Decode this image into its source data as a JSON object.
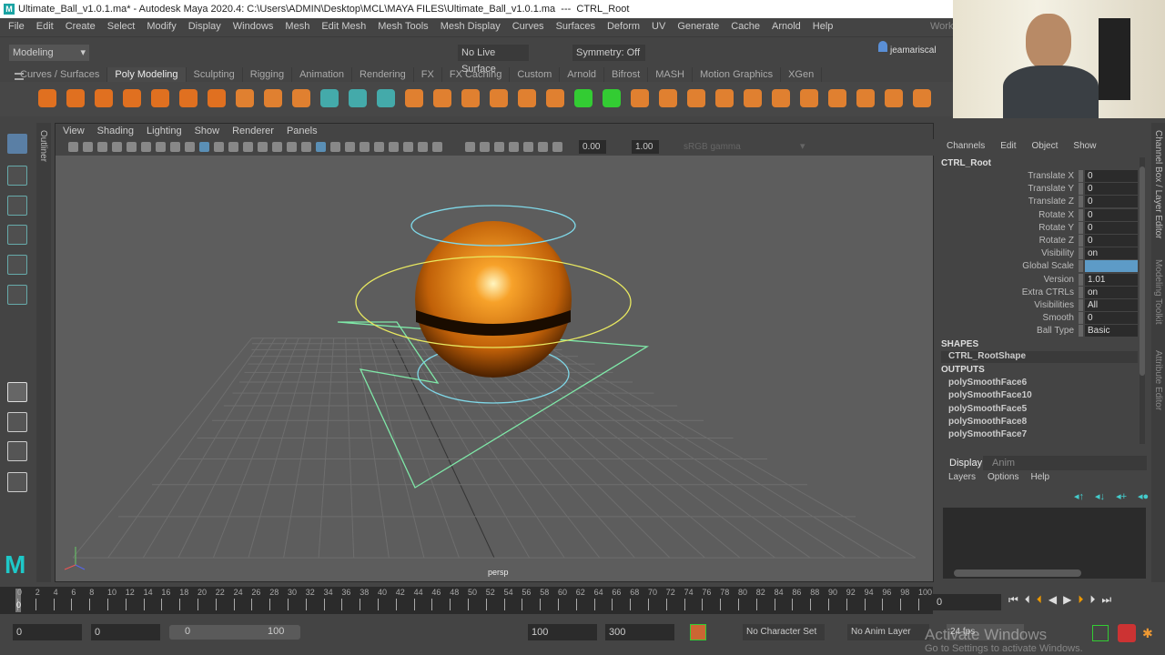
{
  "titlebar": {
    "title": "Ultimate_Ball_v1.0.1.ma* - Autodesk Maya 2020.4: C:\\Users\\ADMIN\\Desktop\\MCL\\MAYA FILES\\Ultimate_Ball_v1.0.1.ma  ---  CTRL_Root"
  },
  "menubar": [
    "File",
    "Edit",
    "Create",
    "Select",
    "Modify",
    "Display",
    "Windows",
    "Mesh",
    "Edit Mesh",
    "Mesh Tools",
    "Mesh Display",
    "Curves",
    "Surfaces",
    "Deform",
    "UV",
    "Generate",
    "Cache",
    "Arnold",
    "Help"
  ],
  "workspace_label": "Work",
  "status": {
    "mode": "Modeling",
    "live_surface": "No Live Surface",
    "symmetry": "Symmetry: Off",
    "user": "jeamariscal"
  },
  "shelf_tabs": [
    "Curves / Surfaces",
    "Poly Modeling",
    "Sculpting",
    "Rigging",
    "Animation",
    "Rendering",
    "FX",
    "FX Caching",
    "Custom",
    "Arnold",
    "Bifrost",
    "MASH",
    "Motion Graphics",
    "XGen"
  ],
  "shelf_active": "Poly Modeling",
  "outliner_tab": "Outliner",
  "viewport": {
    "menu": [
      "View",
      "Shading",
      "Lighting",
      "Show",
      "Renderer",
      "Panels"
    ],
    "exposure": "0.00",
    "gamma": "1.00",
    "color_space": "sRGB gamma",
    "camera": "persp"
  },
  "channel_box": {
    "menu": [
      "Channels",
      "Edit",
      "Object",
      "Show"
    ],
    "object": "CTRL_Root",
    "channels": [
      {
        "label": "Translate X",
        "value": "0"
      },
      {
        "label": "Translate Y",
        "value": "0"
      },
      {
        "label": "Translate Z",
        "value": "0"
      },
      {
        "label": "Rotate X",
        "value": "0"
      },
      {
        "label": "Rotate Y",
        "value": "0"
      },
      {
        "label": "Rotate Z",
        "value": "0"
      },
      {
        "label": "Visibility",
        "value": "on"
      },
      {
        "label": "Global Scale",
        "value": ""
      },
      {
        "label": "Version",
        "value": "1.01"
      },
      {
        "label": "Extra CTRLs",
        "value": "on"
      },
      {
        "label": "Visibilities",
        "value": "All"
      },
      {
        "label": "Smooth",
        "value": "0"
      },
      {
        "label": "Ball Type",
        "value": "Basic"
      }
    ],
    "shapes_header": "SHAPES",
    "shape": "CTRL_RootShape",
    "outputs_header": "OUTPUTS",
    "outputs": [
      "polySmoothFace6",
      "polySmoothFace10",
      "polySmoothFace5",
      "polySmoothFace8",
      "polySmoothFace7"
    ]
  },
  "layer_editor": {
    "tabs": [
      "Display",
      "Anim"
    ],
    "menu": [
      "Layers",
      "Options",
      "Help"
    ]
  },
  "side_tabs": [
    "Channel Box / Layer Editor",
    "Modeling Toolkit",
    "Attribute Editor"
  ],
  "timeline": {
    "ticks": [
      "0",
      "2",
      "4",
      "6",
      "8",
      "10",
      "12",
      "14",
      "16",
      "18",
      "20",
      "22",
      "24",
      "26",
      "28",
      "30",
      "32",
      "34",
      "36",
      "38",
      "40",
      "42",
      "44",
      "46",
      "48",
      "50",
      "52",
      "54",
      "56",
      "58",
      "60",
      "62",
      "64",
      "66",
      "68",
      "70",
      "72",
      "74",
      "76",
      "78",
      "80",
      "82",
      "84",
      "86",
      "88",
      "90",
      "92",
      "94",
      "96",
      "98",
      "100"
    ],
    "current_frame": "0",
    "current_field": "0"
  },
  "range": {
    "start": "0",
    "anim_start": "0",
    "slider_start": "0",
    "slider_end": "100",
    "end": "100",
    "anim_end": "300",
    "character_set": "No Character Set",
    "anim_layer": "No Anim Layer",
    "fps": "24 fps"
  },
  "watermark": {
    "line1": "Activate Windows",
    "line2": "Go to Settings to activate Windows."
  }
}
